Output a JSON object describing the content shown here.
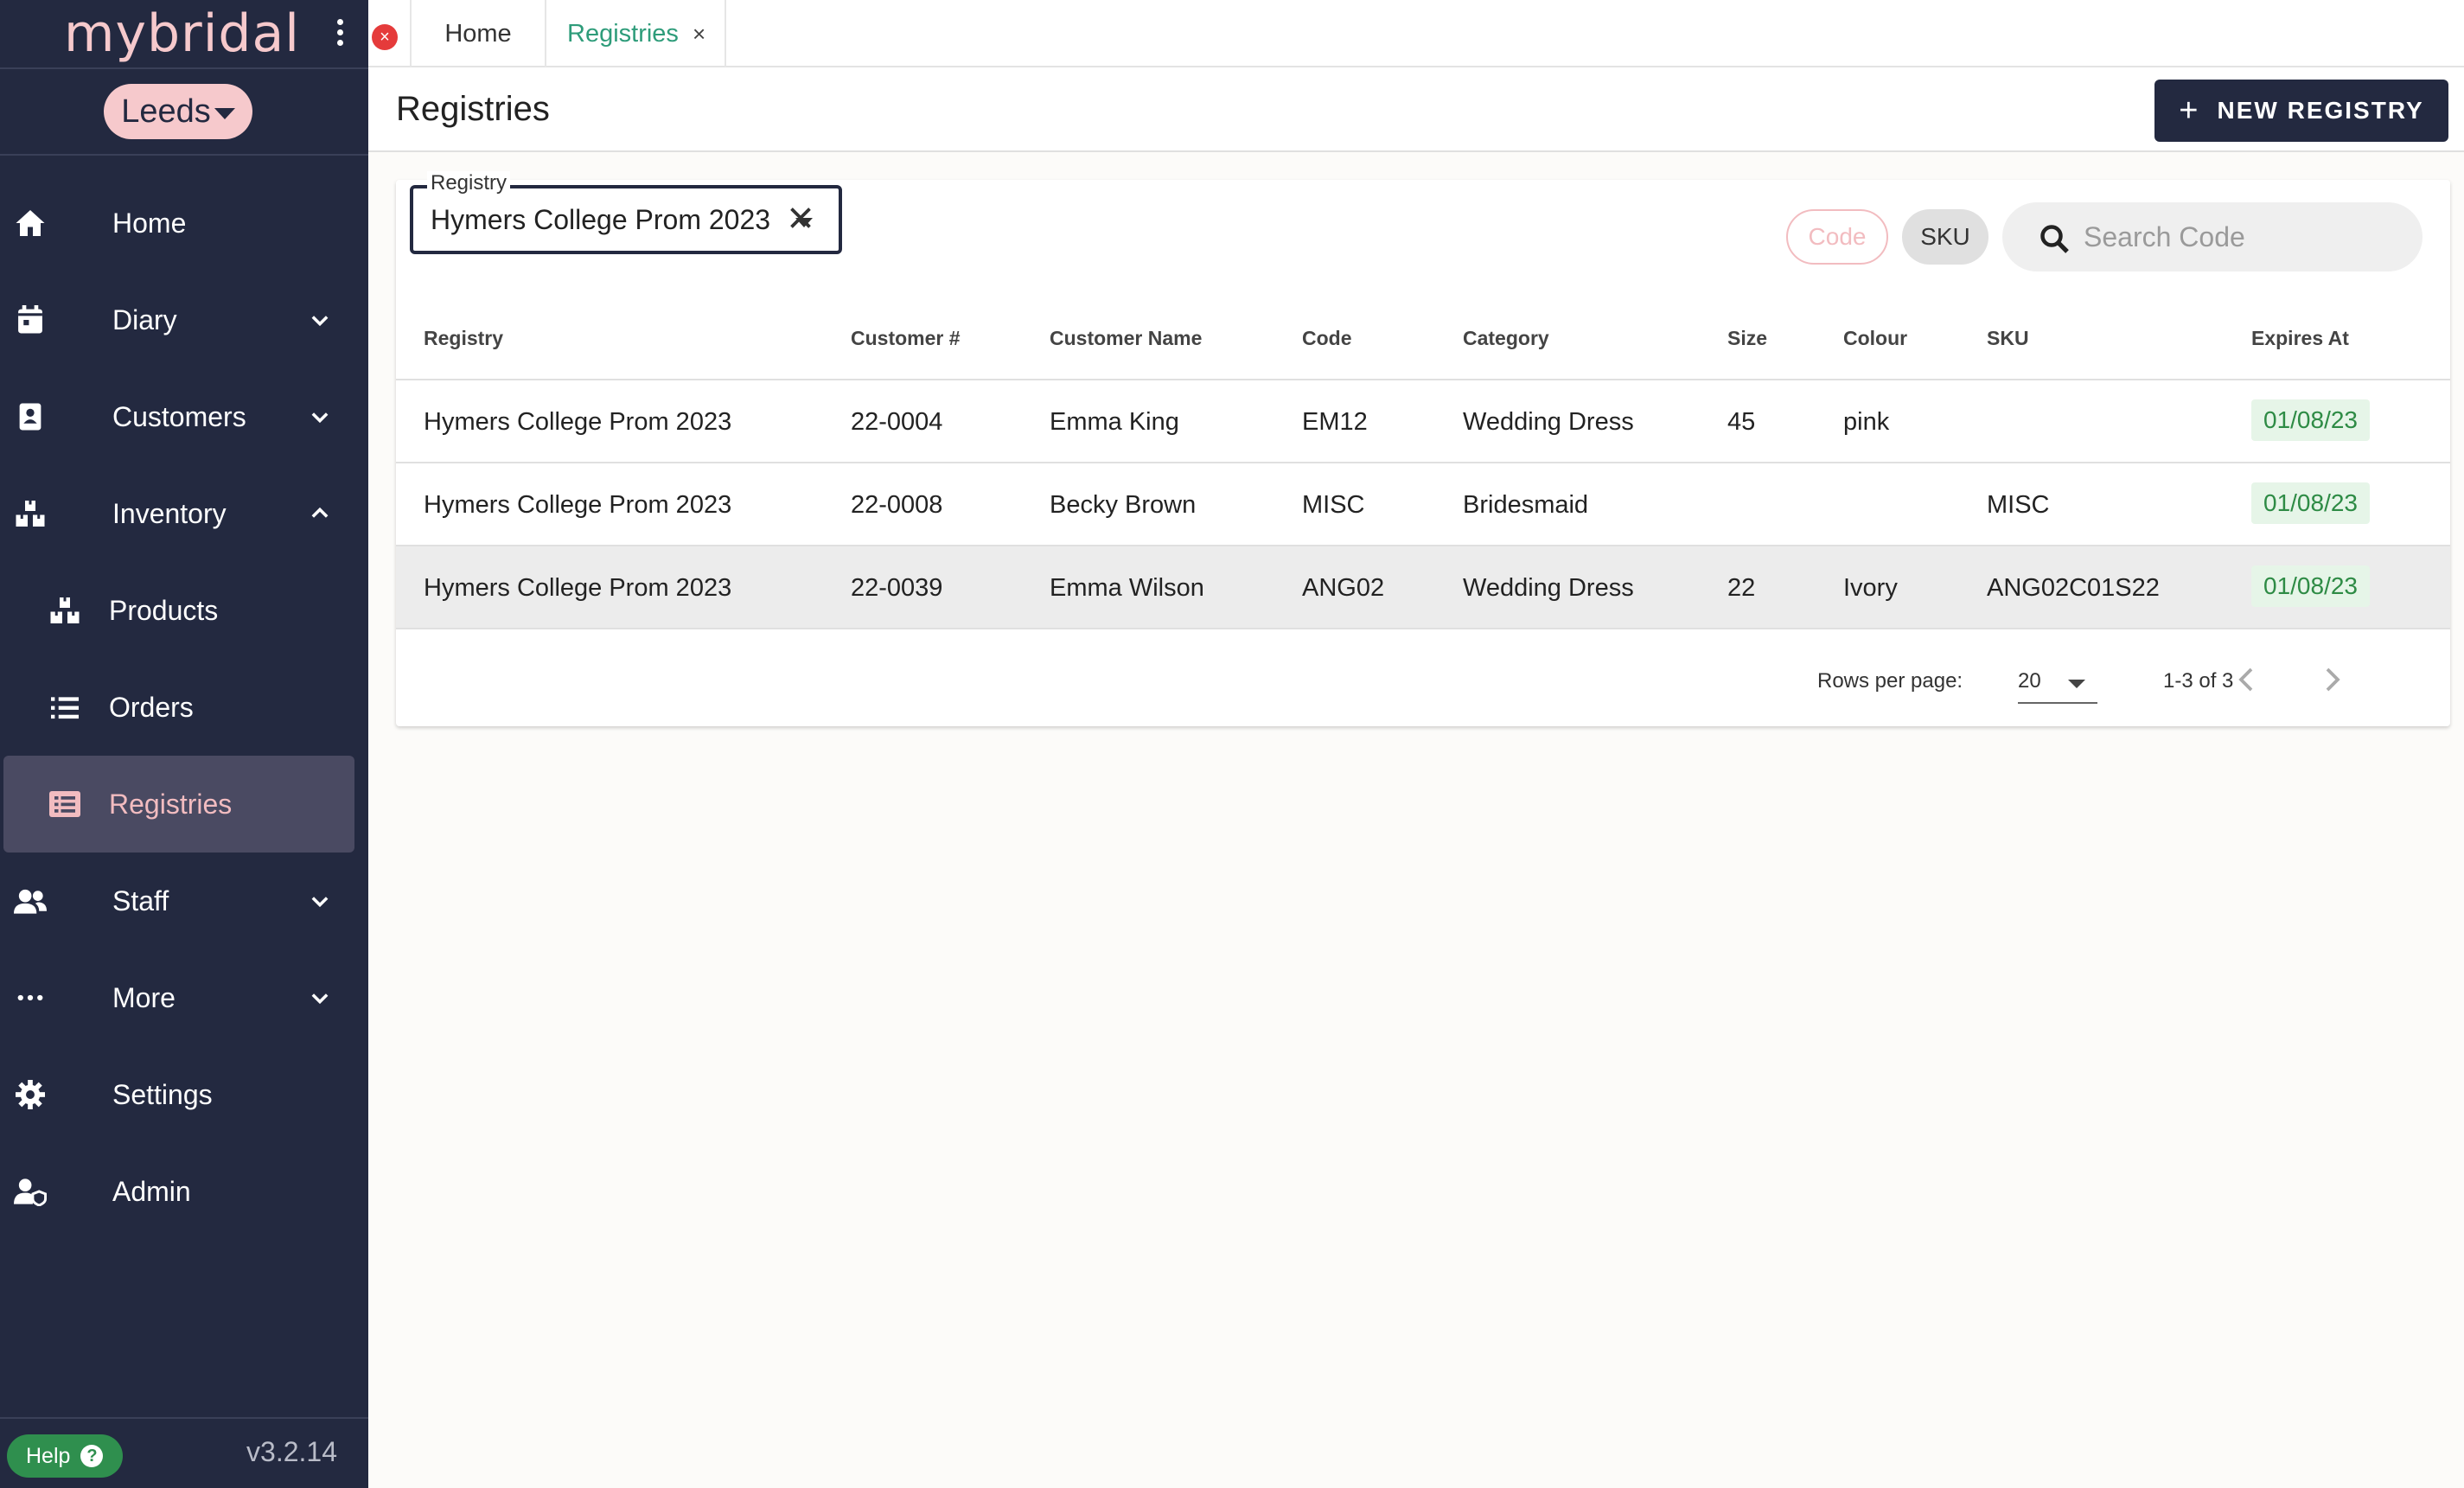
{
  "app": {
    "logo": "mybridal",
    "store": "Leeds",
    "version": "v3.2.14",
    "help_label": "Help"
  },
  "nav": [
    {
      "label": "Home",
      "icon": "home-icon",
      "chevron": ""
    },
    {
      "label": "Diary",
      "icon": "calendar-icon",
      "chevron": "down"
    },
    {
      "label": "Customers",
      "icon": "contact-book-icon",
      "chevron": "down"
    },
    {
      "label": "Inventory",
      "icon": "boxes-icon",
      "chevron": "up"
    },
    {
      "label": "Products",
      "icon": "boxes-icon",
      "sub": true
    },
    {
      "label": "Orders",
      "icon": "list-icon",
      "sub": true
    },
    {
      "label": "Registries",
      "icon": "registry-list-icon",
      "sub": true,
      "active": true
    },
    {
      "label": "Staff",
      "icon": "people-icon",
      "chevron": "down"
    },
    {
      "label": "More",
      "icon": "more-dots-icon",
      "chevron": "down"
    },
    {
      "label": "Settings",
      "icon": "gear-icon",
      "chevron": ""
    },
    {
      "label": "Admin",
      "icon": "admin-user-icon",
      "chevron": ""
    }
  ],
  "tabs": {
    "home": "Home",
    "registries": "Registries",
    "close_glyph": "×"
  },
  "header": {
    "title": "Registries",
    "new_button": "NEW REGISTRY"
  },
  "filter": {
    "registry_legend": "Registry",
    "registry_value": "Hymers College Prom 2023",
    "chip_code": "Code",
    "chip_sku": "SKU",
    "search_placeholder": "Search Code"
  },
  "table": {
    "headers": [
      "Registry",
      "Customer #",
      "Customer Name",
      "Code",
      "Category",
      "Size",
      "Colour",
      "SKU",
      "Expires At"
    ],
    "rows": [
      [
        "Hymers College Prom 2023",
        "22-0004",
        "Emma King",
        "EM12",
        "Wedding Dress",
        "45",
        "pink",
        "",
        "01/08/23"
      ],
      [
        "Hymers College Prom 2023",
        "22-0008",
        "Becky Brown",
        "MISC",
        "Bridesmaid",
        "",
        "",
        "MISC",
        "01/08/23"
      ],
      [
        "Hymers College Prom 2023",
        "22-0039",
        "Emma Wilson",
        "ANG02",
        "Wedding Dress",
        "22",
        "Ivory",
        "ANG02C01S22",
        "01/08/23"
      ]
    ],
    "highlighted_row": 2
  },
  "pagination": {
    "rows_per_page_label": "Rows per page:",
    "rows_per_page": "20",
    "range": "1-3 of 3"
  },
  "colors": {
    "sidebar": "#232940",
    "accent_pink": "#f6c9cc",
    "active_tab": "#2e9c7a",
    "expiry_green": "#2e8b45"
  }
}
